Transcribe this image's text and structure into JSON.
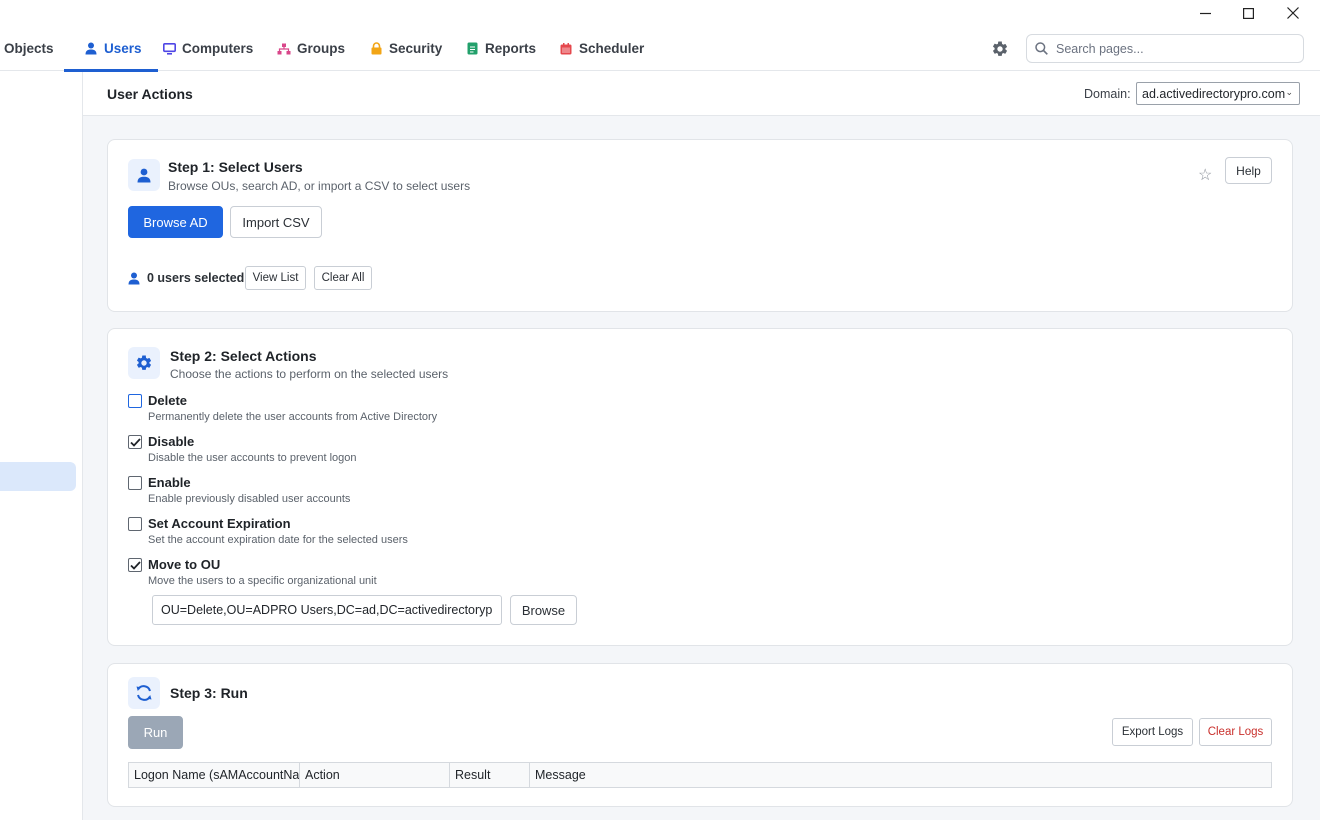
{
  "window": {
    "minimize": "—",
    "maximize": "☐",
    "close": "✕"
  },
  "nav": {
    "tabs": [
      {
        "label": "Objects",
        "icon": "none",
        "active": false
      },
      {
        "label": "Users",
        "icon": "user-icon",
        "active": true
      },
      {
        "label": "Computers",
        "icon": "computer-icon",
        "active": false
      },
      {
        "label": "Groups",
        "icon": "groups-icon",
        "active": false
      },
      {
        "label": "Security",
        "icon": "lock-icon",
        "active": false
      },
      {
        "label": "Reports",
        "icon": "report-icon",
        "active": false
      },
      {
        "label": "Scheduler",
        "icon": "calendar-icon",
        "active": false
      }
    ],
    "search_placeholder": "Search pages..."
  },
  "header": {
    "title": "User Actions",
    "domain_label": "Domain:",
    "domain_value": "ad.activedirectorypro.com"
  },
  "step1": {
    "title": "Step 1: Select Users",
    "subtitle": "Browse OUs, search AD, or import a CSV to select users",
    "browse_label": "Browse AD",
    "import_label": "Import CSV",
    "help_label": "Help",
    "users_selected": "0 users selected",
    "view_list_label": "View List",
    "clear_all_label": "Clear All"
  },
  "step2": {
    "title": "Step 2: Select Actions",
    "subtitle": "Choose the actions to perform on the selected users",
    "actions": [
      {
        "title": "Delete",
        "desc": "Permanently delete the user accounts from Active Directory",
        "checked": false
      },
      {
        "title": "Disable",
        "desc": "Disable the user accounts to prevent logon",
        "checked": true
      },
      {
        "title": "Enable",
        "desc": "Enable previously disabled user accounts",
        "checked": false
      },
      {
        "title": "Set Account Expiration",
        "desc": "Set the account expiration date for the selected users",
        "checked": false
      },
      {
        "title": "Move to OU",
        "desc": "Move the users to a specific organizational unit",
        "checked": true
      }
    ],
    "ou_value": "OU=Delete,OU=ADPRO Users,DC=ad,DC=activedirectorypro,DC=com",
    "browse_label": "Browse"
  },
  "step3": {
    "title": "Step 3: Run",
    "run_label": "Run",
    "export_label": "Export Logs",
    "clear_logs_label": "Clear Logs",
    "columns": [
      "Logon Name (sAMAccountName)",
      "Action",
      "Result",
      "Message"
    ]
  },
  "colors": {
    "accent": "#1e5fd1",
    "primary_button": "#1f66e0",
    "disabled_button": "#9ba7b6",
    "danger_text": "#c9302c",
    "selected_sidebar": "#dbe8fb"
  }
}
